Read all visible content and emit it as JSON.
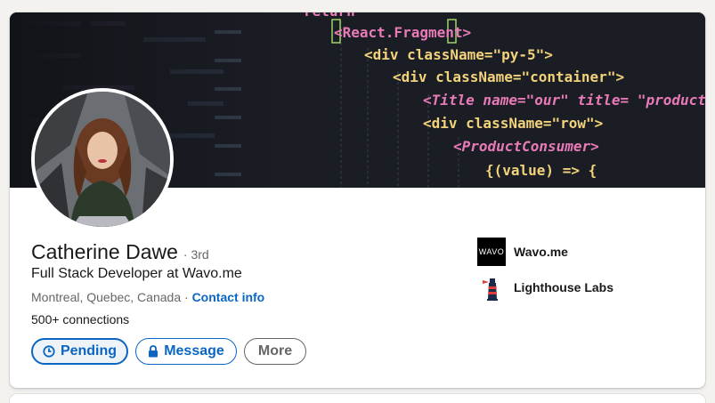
{
  "profile": {
    "name": "Catherine Dawe",
    "degree": "· 3rd",
    "headline": "Full Stack Developer at Wavo.me",
    "location": "Montreal, Quebec, Canada",
    "separator": " · ",
    "contact_info": "Contact info",
    "connections": "500+ connections"
  },
  "actions": {
    "pending_label": "Pending",
    "message_label": "Message",
    "more_label": "More"
  },
  "organizations": [
    {
      "name": "Wavo.me",
      "logo_text": "WAVO",
      "logo_icon": "wavo-logo"
    },
    {
      "name": "Lighthouse Labs",
      "logo_icon": "lighthouse-logo"
    }
  ],
  "banner": {
    "code_lines": [
      "return",
      "<React.Fragment>",
      "<div className=\"py-5\">",
      "<div className=\"container\">",
      "<Title name=\"our\" title= \"product",
      "<div className=\"row\">",
      "<ProductConsumer>",
      "{(value) => {"
    ]
  },
  "colors": {
    "accent": "#0a66c2",
    "banner_bg": "#1a1d24",
    "code_yellow": "#f2d27a",
    "code_pink": "#e87ab8",
    "code_green": "#9fd36b"
  }
}
